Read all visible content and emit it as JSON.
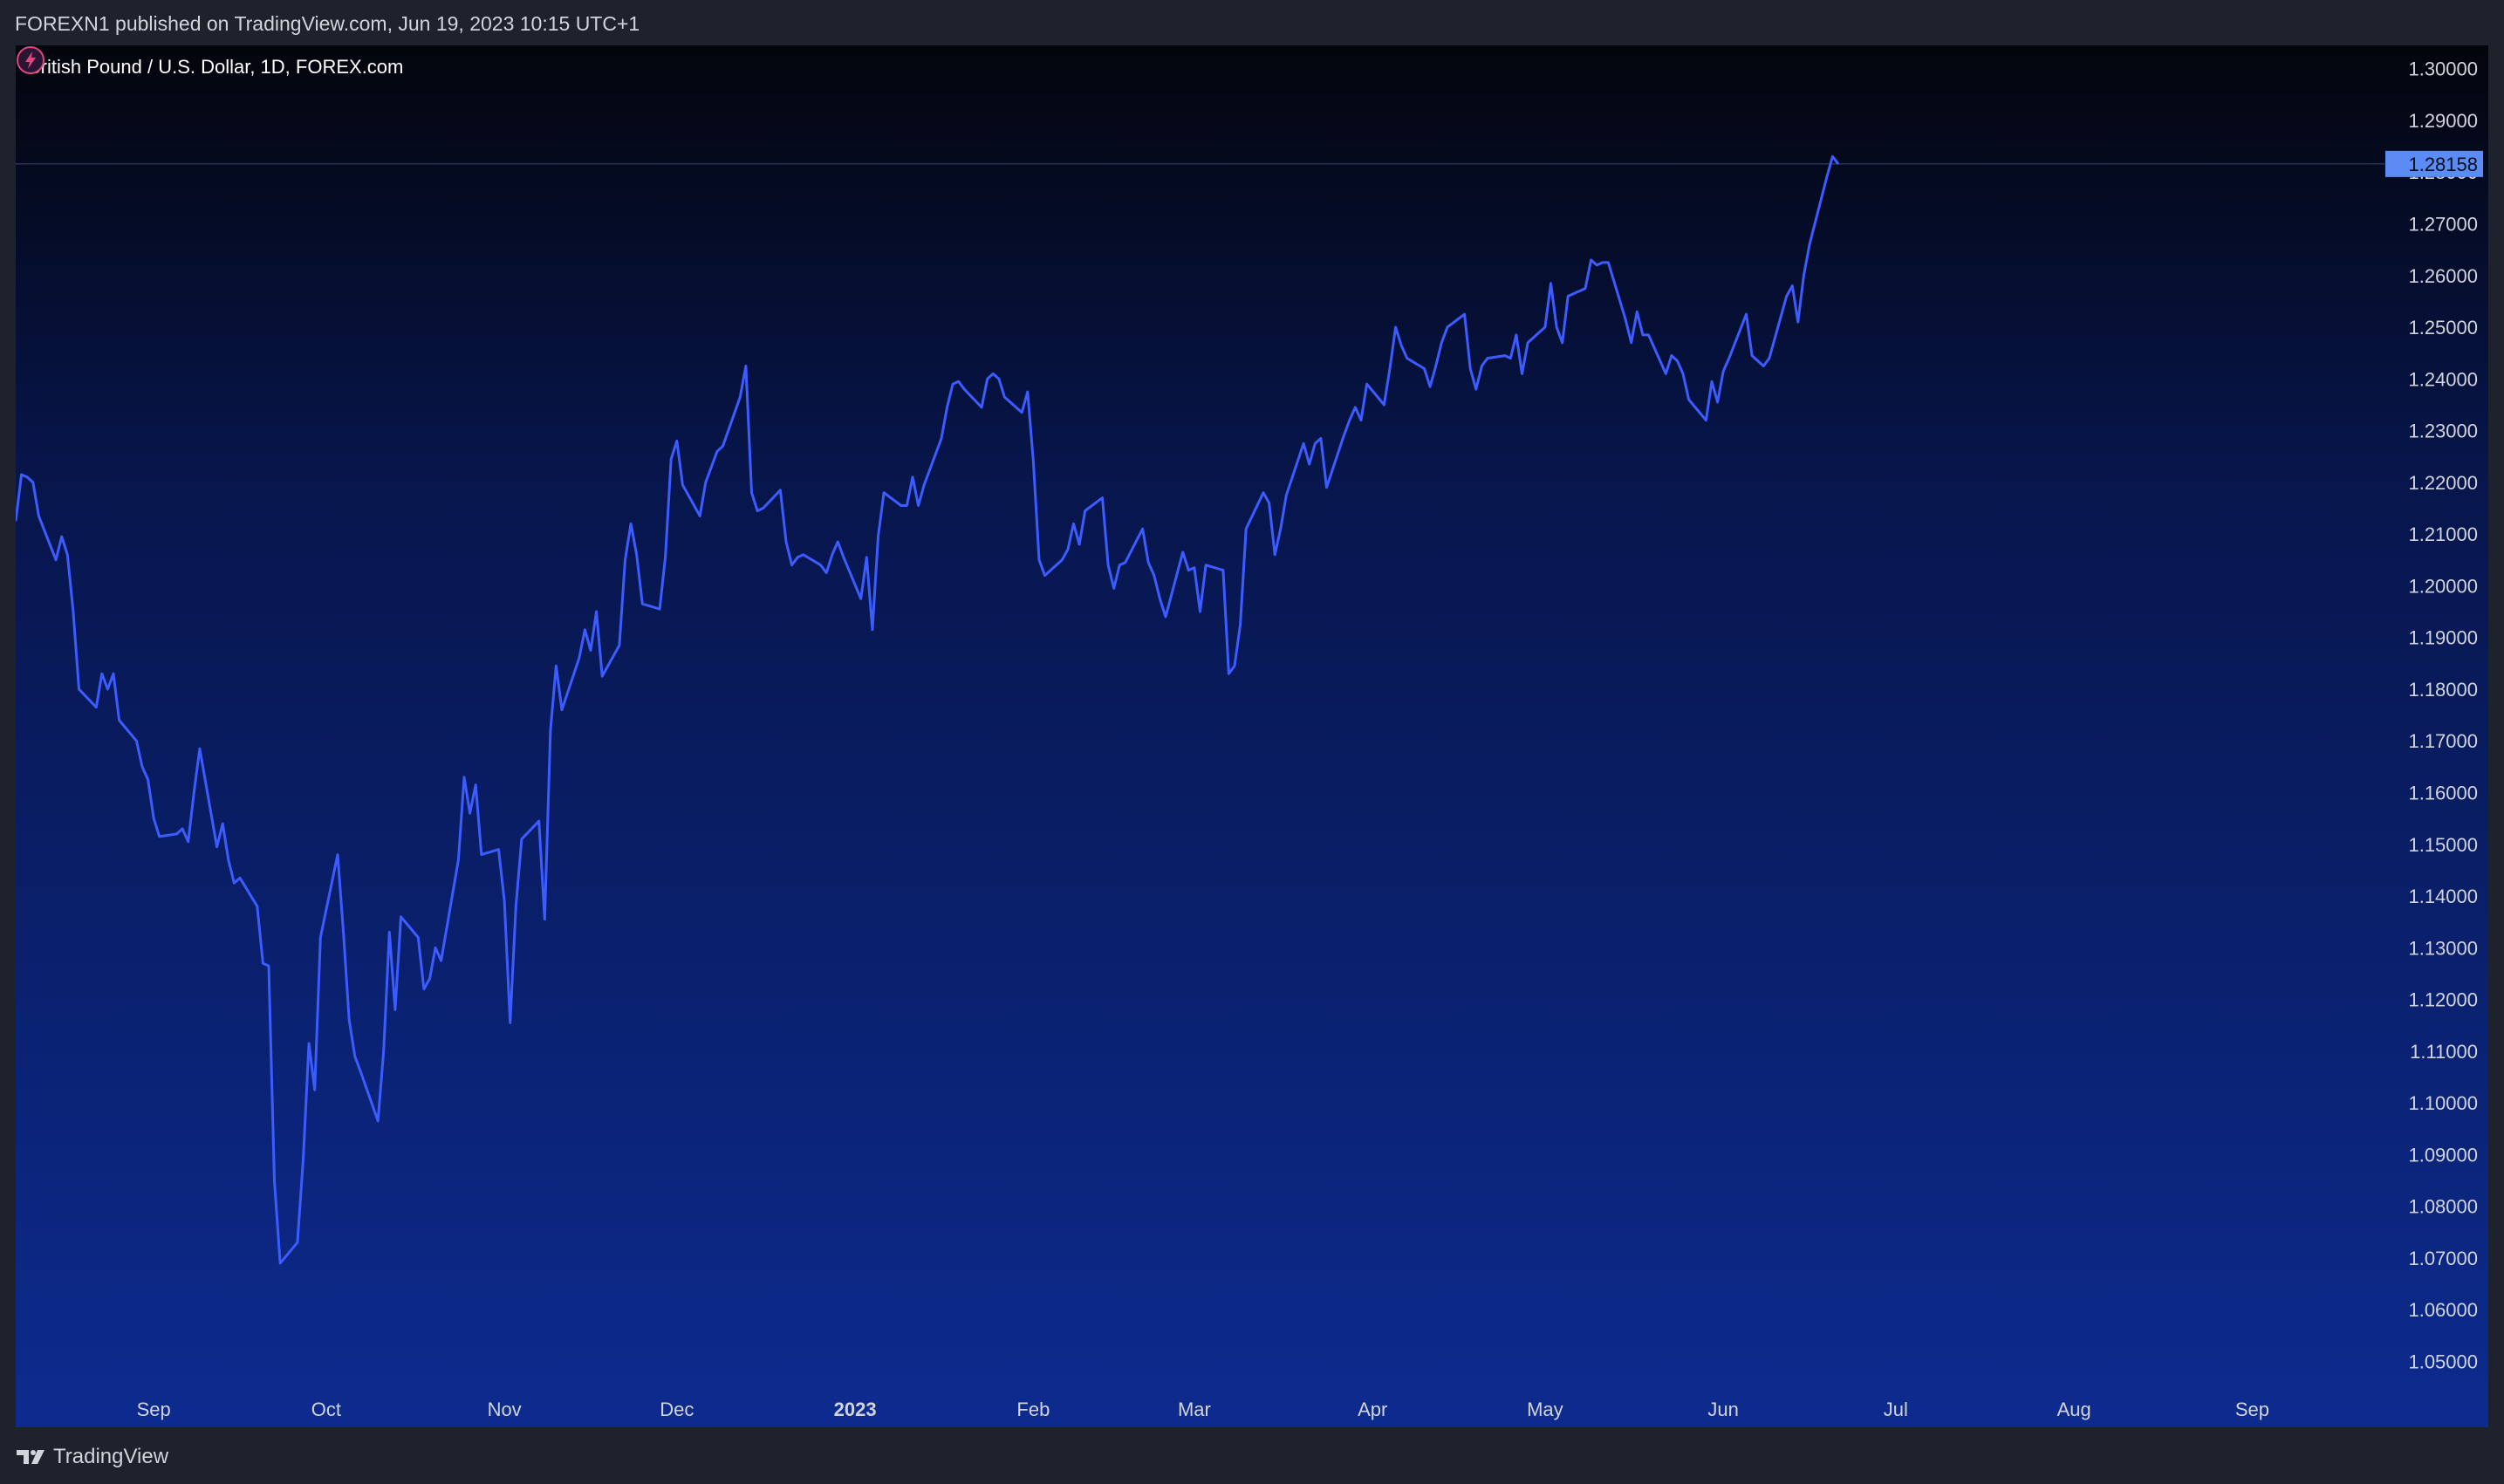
{
  "header": {
    "publish_text": "FOREXN1 published on TradingView.com, Jun 19, 2023 10:15 UTC+1"
  },
  "footer": {
    "brand": "TradingView"
  },
  "colors": {
    "line": "#3d5cff",
    "price_label_bg": "#5b8cf5",
    "axis_text": "#d1d4dc",
    "bg_top": "#03050c",
    "bg_bottom": "#0d2b8f"
  },
  "icons": {
    "logo": "tradingview-logo-icon",
    "alert": "lightning-icon"
  },
  "chart_data": {
    "type": "line",
    "title": "British Pound / U.S. Dollar, 1D, FOREX.com",
    "last_price": 1.28158,
    "last_price_label": "1.28158",
    "ylim": [
      1.043,
      1.3045
    ],
    "y_ticks": [
      "1.30000",
      "1.29000",
      "1.28000",
      "1.27000",
      "1.26000",
      "1.25000",
      "1.24000",
      "1.23000",
      "1.22000",
      "1.21000",
      "1.20000",
      "1.19000",
      "1.18000",
      "1.17000",
      "1.16000",
      "1.15000",
      "1.14000",
      "1.13000",
      "1.12000",
      "1.11000",
      "1.10000",
      "1.09000",
      "1.08000",
      "1.07000",
      "1.06000",
      "1.05000"
    ],
    "x_ticks": [
      {
        "label": "Sep",
        "date": "2022-09-01"
      },
      {
        "label": "Oct",
        "date": "2022-10-01"
      },
      {
        "label": "Nov",
        "date": "2022-11-01"
      },
      {
        "label": "Dec",
        "date": "2022-12-01"
      },
      {
        "label": "2023",
        "date": "2023-01-01"
      },
      {
        "label": "Feb",
        "date": "2023-02-01"
      },
      {
        "label": "Mar",
        "date": "2023-03-01"
      },
      {
        "label": "Apr",
        "date": "2023-04-01"
      },
      {
        "label": "May",
        "date": "2023-05-01"
      },
      {
        "label": "Jun",
        "date": "2023-06-01"
      },
      {
        "label": "Jul",
        "date": "2023-07-01"
      },
      {
        "label": "Aug",
        "date": "2023-08-01"
      },
      {
        "label": "Sep",
        "date": "2023-09-01"
      }
    ],
    "xlim": [
      "2022-08-08",
      "2023-09-24"
    ],
    "grid": false,
    "series": [
      {
        "values": [
          [
            "2022-08-08",
            1.2125
          ],
          [
            "2022-08-09",
            1.2215
          ],
          [
            "2022-08-10",
            1.221
          ],
          [
            "2022-08-11",
            1.22
          ],
          [
            "2022-08-12",
            1.2135
          ],
          [
            "2022-08-15",
            1.205
          ],
          [
            "2022-08-16",
            1.2095
          ],
          [
            "2022-08-17",
            1.206
          ],
          [
            "2022-08-18",
            1.195
          ],
          [
            "2022-08-19",
            1.18
          ],
          [
            "2022-08-22",
            1.1765
          ],
          [
            "2022-08-23",
            1.183
          ],
          [
            "2022-08-24",
            1.18
          ],
          [
            "2022-08-25",
            1.183
          ],
          [
            "2022-08-26",
            1.174
          ],
          [
            "2022-08-29",
            1.17
          ],
          [
            "2022-08-30",
            1.165
          ],
          [
            "2022-08-31",
            1.1625
          ],
          [
            "2022-09-01",
            1.155
          ],
          [
            "2022-09-02",
            1.1515
          ],
          [
            "2022-09-05",
            1.152
          ],
          [
            "2022-09-06",
            1.153
          ],
          [
            "2022-09-07",
            1.1505
          ],
          [
            "2022-09-08",
            1.16
          ],
          [
            "2022-09-09",
            1.1685
          ],
          [
            "2022-09-12",
            1.1495
          ],
          [
            "2022-09-13",
            1.154
          ],
          [
            "2022-09-14",
            1.147
          ],
          [
            "2022-09-15",
            1.1425
          ],
          [
            "2022-09-16",
            1.1435
          ],
          [
            "2022-09-19",
            1.138
          ],
          [
            "2022-09-20",
            1.127
          ],
          [
            "2022-09-21",
            1.1265
          ],
          [
            "2022-09-22",
            1.085
          ],
          [
            "2022-09-23",
            1.069
          ],
          [
            "2022-09-26",
            1.073
          ],
          [
            "2022-09-27",
            1.089
          ],
          [
            "2022-09-28",
            1.1115
          ],
          [
            "2022-09-29",
            1.1025
          ],
          [
            "2022-09-30",
            1.132
          ],
          [
            "2022-10-03",
            1.148
          ],
          [
            "2022-10-04",
            1.133
          ],
          [
            "2022-10-05",
            1.116
          ],
          [
            "2022-10-06",
            1.109
          ],
          [
            "2022-10-07",
            1.106
          ],
          [
            "2022-10-10",
            1.0965
          ],
          [
            "2022-10-11",
            1.11
          ],
          [
            "2022-10-12",
            1.133
          ],
          [
            "2022-10-13",
            1.118
          ],
          [
            "2022-10-14",
            1.136
          ],
          [
            "2022-10-17",
            1.132
          ],
          [
            "2022-10-18",
            1.122
          ],
          [
            "2022-10-19",
            1.124
          ],
          [
            "2022-10-20",
            1.13
          ],
          [
            "2022-10-21",
            1.1275
          ],
          [
            "2022-10-24",
            1.147
          ],
          [
            "2022-10-25",
            1.163
          ],
          [
            "2022-10-26",
            1.156
          ],
          [
            "2022-10-27",
            1.1615
          ],
          [
            "2022-10-28",
            1.148
          ],
          [
            "2022-10-31",
            1.149
          ],
          [
            "2022-11-01",
            1.139
          ],
          [
            "2022-11-02",
            1.1155
          ],
          [
            "2022-11-03",
            1.138
          ],
          [
            "2022-11-04",
            1.151
          ],
          [
            "2022-11-07",
            1.1545
          ],
          [
            "2022-11-08",
            1.1355
          ],
          [
            "2022-11-09",
            1.172
          ],
          [
            "2022-11-10",
            1.1845
          ],
          [
            "2022-11-11",
            1.176
          ],
          [
            "2022-11-14",
            1.186
          ],
          [
            "2022-11-15",
            1.1915
          ],
          [
            "2022-11-16",
            1.1875
          ],
          [
            "2022-11-17",
            1.195
          ],
          [
            "2022-11-18",
            1.1825
          ],
          [
            "2022-11-21",
            1.1885
          ],
          [
            "2022-11-22",
            1.205
          ],
          [
            "2022-11-23",
            1.212
          ],
          [
            "2022-11-24",
            1.206
          ],
          [
            "2022-11-25",
            1.1965
          ],
          [
            "2022-11-28",
            1.1955
          ],
          [
            "2022-11-29",
            1.2055
          ],
          [
            "2022-11-30",
            1.2245
          ],
          [
            "2022-12-01",
            1.228
          ],
          [
            "2022-12-02",
            1.2195
          ],
          [
            "2022-12-05",
            1.2135
          ],
          [
            "2022-12-06",
            1.22
          ],
          [
            "2022-12-07",
            1.223
          ],
          [
            "2022-12-08",
            1.226
          ],
          [
            "2022-12-09",
            1.227
          ],
          [
            "2022-12-12",
            1.2365
          ],
          [
            "2022-12-13",
            1.2425
          ],
          [
            "2022-12-14",
            1.218
          ],
          [
            "2022-12-15",
            1.2145
          ],
          [
            "2022-12-16",
            1.215
          ],
          [
            "2022-12-19",
            1.2185
          ],
          [
            "2022-12-20",
            1.2085
          ],
          [
            "2022-12-21",
            1.204
          ],
          [
            "2022-12-22",
            1.2055
          ],
          [
            "2022-12-23",
            1.206
          ],
          [
            "2022-12-26",
            1.204
          ],
          [
            "2022-12-27",
            1.2025
          ],
          [
            "2022-12-28",
            1.206
          ],
          [
            "2022-12-29",
            1.2085
          ],
          [
            "2022-12-30",
            1.2055
          ],
          [
            "2023-01-02",
            1.1975
          ],
          [
            "2023-01-03",
            1.2055
          ],
          [
            "2023-01-04",
            1.1915
          ],
          [
            "2023-01-05",
            1.2095
          ],
          [
            "2023-01-06",
            1.218
          ],
          [
            "2023-01-09",
            1.2155
          ],
          [
            "2023-01-10",
            1.2155
          ],
          [
            "2023-01-11",
            1.221
          ],
          [
            "2023-01-12",
            1.2155
          ],
          [
            "2023-01-13",
            1.2195
          ],
          [
            "2023-01-16",
            1.2285
          ],
          [
            "2023-01-17",
            1.2345
          ],
          [
            "2023-01-18",
            1.239
          ],
          [
            "2023-01-19",
            1.2395
          ],
          [
            "2023-01-20",
            1.238
          ],
          [
            "2023-01-23",
            1.2345
          ],
          [
            "2023-01-24",
            1.24
          ],
          [
            "2023-01-25",
            1.241
          ],
          [
            "2023-01-26",
            1.24
          ],
          [
            "2023-01-27",
            1.2365
          ],
          [
            "2023-01-30",
            1.2335
          ],
          [
            "2023-01-31",
            1.2375
          ],
          [
            "2023-02-01",
            1.224
          ],
          [
            "2023-02-02",
            1.205
          ],
          [
            "2023-02-03",
            1.202
          ],
          [
            "2023-02-06",
            1.205
          ],
          [
            "2023-02-07",
            1.207
          ],
          [
            "2023-02-08",
            1.212
          ],
          [
            "2023-02-09",
            1.208
          ],
          [
            "2023-02-10",
            1.2145
          ],
          [
            "2023-02-13",
            1.217
          ],
          [
            "2023-02-14",
            1.204
          ],
          [
            "2023-02-15",
            1.1995
          ],
          [
            "2023-02-16",
            1.204
          ],
          [
            "2023-02-17",
            1.2045
          ],
          [
            "2023-02-20",
            1.211
          ],
          [
            "2023-02-21",
            1.2045
          ],
          [
            "2023-02-22",
            1.202
          ],
          [
            "2023-02-23",
            1.1975
          ],
          [
            "2023-02-24",
            1.194
          ],
          [
            "2023-02-27",
            1.2065
          ],
          [
            "2023-02-28",
            1.203
          ],
          [
            "2023-03-01",
            1.2035
          ],
          [
            "2023-03-02",
            1.195
          ],
          [
            "2023-03-03",
            1.204
          ],
          [
            "2023-03-06",
            1.203
          ],
          [
            "2023-03-07",
            1.183
          ],
          [
            "2023-03-08",
            1.1845
          ],
          [
            "2023-03-09",
            1.1925
          ],
          [
            "2023-03-10",
            1.211
          ],
          [
            "2023-03-13",
            1.218
          ],
          [
            "2023-03-14",
            1.216
          ],
          [
            "2023-03-15",
            1.206
          ],
          [
            "2023-03-16",
            1.211
          ],
          [
            "2023-03-17",
            1.2175
          ],
          [
            "2023-03-20",
            1.2275
          ],
          [
            "2023-03-21",
            1.2235
          ],
          [
            "2023-03-22",
            1.2275
          ],
          [
            "2023-03-23",
            1.2285
          ],
          [
            "2023-03-24",
            1.219
          ],
          [
            "2023-03-27",
            1.229
          ],
          [
            "2023-03-28",
            1.232
          ],
          [
            "2023-03-29",
            1.2345
          ],
          [
            "2023-03-30",
            1.232
          ],
          [
            "2023-03-31",
            1.239
          ],
          [
            "2023-04-03",
            1.235
          ],
          [
            "2023-04-04",
            1.242
          ],
          [
            "2023-04-05",
            1.25
          ],
          [
            "2023-04-06",
            1.2465
          ],
          [
            "2023-04-07",
            1.244
          ],
          [
            "2023-04-10",
            1.242
          ],
          [
            "2023-04-11",
            1.2385
          ],
          [
            "2023-04-12",
            1.2425
          ],
          [
            "2023-04-13",
            1.247
          ],
          [
            "2023-04-14",
            1.25
          ],
          [
            "2023-04-17",
            1.2525
          ],
          [
            "2023-04-18",
            1.242
          ],
          [
            "2023-04-19",
            1.238
          ],
          [
            "2023-04-20",
            1.2425
          ],
          [
            "2023-04-21",
            1.244
          ],
          [
            "2023-04-24",
            1.2445
          ],
          [
            "2023-04-25",
            1.244
          ],
          [
            "2023-04-26",
            1.2485
          ],
          [
            "2023-04-27",
            1.241
          ],
          [
            "2023-04-28",
            1.247
          ],
          [
            "2023-05-01",
            1.25
          ],
          [
            "2023-05-02",
            1.2585
          ],
          [
            "2023-05-03",
            1.25
          ],
          [
            "2023-05-04",
            1.247
          ],
          [
            "2023-05-05",
            1.256
          ],
          [
            "2023-05-08",
            1.2575
          ],
          [
            "2023-05-09",
            1.263
          ],
          [
            "2023-05-10",
            1.262
          ],
          [
            "2023-05-11",
            1.2625
          ],
          [
            "2023-05-12",
            1.2625
          ],
          [
            "2023-05-15",
            1.2515
          ],
          [
            "2023-05-16",
            1.247
          ],
          [
            "2023-05-17",
            1.253
          ],
          [
            "2023-05-18",
            1.2485
          ],
          [
            "2023-05-19",
            1.2485
          ],
          [
            "2023-05-22",
            1.241
          ],
          [
            "2023-05-23",
            1.2445
          ],
          [
            "2023-05-24",
            1.2435
          ],
          [
            "2023-05-25",
            1.241
          ],
          [
            "2023-05-26",
            1.236
          ],
          [
            "2023-05-29",
            1.232
          ],
          [
            "2023-05-30",
            1.2395
          ],
          [
            "2023-05-31",
            1.2355
          ],
          [
            "2023-06-01",
            1.2415
          ],
          [
            "2023-06-02",
            1.244
          ],
          [
            "2023-06-05",
            1.2525
          ],
          [
            "2023-06-06",
            1.2445
          ],
          [
            "2023-06-07",
            1.2435
          ],
          [
            "2023-06-08",
            1.2425
          ],
          [
            "2023-06-09",
            1.244
          ],
          [
            "2023-06-12",
            1.256
          ],
          [
            "2023-06-13",
            1.258
          ],
          [
            "2023-06-14",
            1.251
          ],
          [
            "2023-06-15",
            1.26
          ],
          [
            "2023-06-16",
            1.266
          ],
          [
            "2023-06-19",
            1.279
          ],
          [
            "2023-06-20",
            1.283
          ],
          [
            "2023-06-21",
            1.28158
          ]
        ]
      }
    ]
  }
}
